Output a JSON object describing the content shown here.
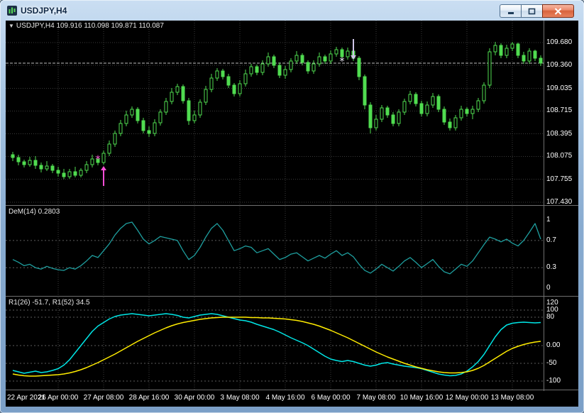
{
  "window": {
    "title": "USDJPY,H4"
  },
  "icons": {
    "triangle_down": "▼",
    "star": "*"
  },
  "chart": {
    "header": {
      "symbol": "USDJPY,H4",
      "quote": "109.916 110.098 109.871 110.087"
    }
  },
  "chart_data": {
    "type": "candlestick",
    "symbol": "USDJPY",
    "timeframe": "H4",
    "bar_count": 94,
    "price_range": [
      107.39,
      109.99
    ],
    "bid": 109.39,
    "price_ticks": [
      {
        "label": "109.680",
        "value": 109.68
      },
      {
        "label": "109.360",
        "value": 109.36
      },
      {
        "label": "109.035",
        "value": 109.035
      },
      {
        "label": "108.715",
        "value": 108.715
      },
      {
        "label": "108.395",
        "value": 108.395
      },
      {
        "label": "108.075",
        "value": 108.075
      },
      {
        "label": "107.755",
        "value": 107.755
      },
      {
        "label": "107.430",
        "value": 107.43
      }
    ],
    "time_ticks": [
      {
        "bar": 0,
        "label": "22 Apr 2021"
      },
      {
        "bar": 8,
        "label": "26 Apr 00:00"
      },
      {
        "bar": 16,
        "label": "27 Apr 08:00"
      },
      {
        "bar": 24,
        "label": "28 Apr 16:00"
      },
      {
        "bar": 32,
        "label": "30 Apr 00:00"
      },
      {
        "bar": 40,
        "label": "3 May 08:00"
      },
      {
        "bar": 48,
        "label": "4 May 16:00"
      },
      {
        "bar": 56,
        "label": "6 May 00:00"
      },
      {
        "bar": 64,
        "label": "7 May 08:00"
      },
      {
        "bar": 72,
        "label": "10 May 16:00"
      },
      {
        "bar": 80,
        "label": "12 May 00:00"
      },
      {
        "bar": 88,
        "label": "13 May 08:00"
      }
    ],
    "candles": [
      [
        108.1,
        108.14,
        108.01,
        108.06
      ],
      [
        108.06,
        108.1,
        107.95,
        108.0
      ],
      [
        108.0,
        108.03,
        107.92,
        107.96
      ],
      [
        107.96,
        108.07,
        107.93,
        108.02
      ],
      [
        108.02,
        108.08,
        107.9,
        107.95
      ],
      [
        107.95,
        107.99,
        107.85,
        107.9
      ],
      [
        107.9,
        108.01,
        107.87,
        107.94
      ],
      [
        107.94,
        107.97,
        107.84,
        107.88
      ],
      [
        107.88,
        107.93,
        107.79,
        107.84
      ],
      [
        107.84,
        107.9,
        107.755,
        107.79
      ],
      [
        107.79,
        107.9,
        107.76,
        107.86
      ],
      [
        107.86,
        107.93,
        107.78,
        107.81
      ],
      [
        107.81,
        107.91,
        107.78,
        107.88
      ],
      [
        107.88,
        108.01,
        107.84,
        107.96
      ],
      [
        107.96,
        108.1,
        107.92,
        108.04
      ],
      [
        108.04,
        108.08,
        107.95,
        107.99
      ],
      [
        107.99,
        108.16,
        107.96,
        108.12
      ],
      [
        108.12,
        108.3,
        108.08,
        108.25
      ],
      [
        108.25,
        108.44,
        108.21,
        108.4
      ],
      [
        108.4,
        108.59,
        108.36,
        108.54
      ],
      [
        108.54,
        108.72,
        108.5,
        108.66
      ],
      [
        108.66,
        108.78,
        108.62,
        108.74
      ],
      [
        108.74,
        108.77,
        108.54,
        108.58
      ],
      [
        108.58,
        108.62,
        108.4,
        108.44
      ],
      [
        108.44,
        108.5,
        108.35,
        108.4
      ],
      [
        108.4,
        108.6,
        108.36,
        108.55
      ],
      [
        108.55,
        108.74,
        108.51,
        108.7
      ],
      [
        108.7,
        108.9,
        108.66,
        108.85
      ],
      [
        108.85,
        109.04,
        108.81,
        108.98
      ],
      [
        108.98,
        109.1,
        108.94,
        109.06
      ],
      [
        109.06,
        109.09,
        108.82,
        108.86
      ],
      [
        108.86,
        108.9,
        108.52,
        108.58
      ],
      [
        108.58,
        108.72,
        108.54,
        108.66
      ],
      [
        108.66,
        108.88,
        108.62,
        108.84
      ],
      [
        108.84,
        109.07,
        108.8,
        109.02
      ],
      [
        109.02,
        109.24,
        108.98,
        109.18
      ],
      [
        109.18,
        109.32,
        109.14,
        109.28
      ],
      [
        109.28,
        109.31,
        109.16,
        109.2
      ],
      [
        109.2,
        109.24,
        109.04,
        109.08
      ],
      [
        109.08,
        109.11,
        108.92,
        108.96
      ],
      [
        108.96,
        109.15,
        108.92,
        109.1
      ],
      [
        109.1,
        109.3,
        109.06,
        109.24
      ],
      [
        109.24,
        109.38,
        109.2,
        109.34
      ],
      [
        109.34,
        109.37,
        109.22,
        109.26
      ],
      [
        109.26,
        109.43,
        109.22,
        109.38
      ],
      [
        109.38,
        109.54,
        109.34,
        109.48
      ],
      [
        109.48,
        109.51,
        109.32,
        109.36
      ],
      [
        109.36,
        109.4,
        109.18,
        109.22
      ],
      [
        109.22,
        109.35,
        109.17,
        109.3
      ],
      [
        109.3,
        109.46,
        109.26,
        109.42
      ],
      [
        109.42,
        109.56,
        109.38,
        109.5
      ],
      [
        109.5,
        109.53,
        109.36,
        109.4
      ],
      [
        109.4,
        109.43,
        109.24,
        109.28
      ],
      [
        109.28,
        109.43,
        109.24,
        109.38
      ],
      [
        109.38,
        109.54,
        109.34,
        109.48
      ],
      [
        109.48,
        109.51,
        109.38,
        109.42
      ],
      [
        109.42,
        109.57,
        109.38,
        109.52
      ],
      [
        109.52,
        109.62,
        109.48,
        109.58
      ],
      [
        109.58,
        109.61,
        109.44,
        109.48
      ],
      [
        109.48,
        109.61,
        109.44,
        109.56
      ],
      [
        109.56,
        109.6,
        109.42,
        109.46
      ],
      [
        109.46,
        109.49,
        109.15,
        109.2
      ],
      [
        109.2,
        109.23,
        108.74,
        108.8
      ],
      [
        108.8,
        108.84,
        108.4,
        108.48
      ],
      [
        108.48,
        108.66,
        108.44,
        108.6
      ],
      [
        108.6,
        108.8,
        108.56,
        108.76
      ],
      [
        108.76,
        108.79,
        108.62,
        108.66
      ],
      [
        108.66,
        108.7,
        108.5,
        108.54
      ],
      [
        108.54,
        108.74,
        108.5,
        108.7
      ],
      [
        108.7,
        108.89,
        108.66,
        108.85
      ],
      [
        108.85,
        109.0,
        108.81,
        108.95
      ],
      [
        108.95,
        108.98,
        108.78,
        108.82
      ],
      [
        108.82,
        108.86,
        108.64,
        108.68
      ],
      [
        108.68,
        108.85,
        108.64,
        108.8
      ],
      [
        108.8,
        108.97,
        108.76,
        108.92
      ],
      [
        108.92,
        108.95,
        108.7,
        108.74
      ],
      [
        108.74,
        108.78,
        108.52,
        108.56
      ],
      [
        108.56,
        108.61,
        108.44,
        108.48
      ],
      [
        108.48,
        108.66,
        108.44,
        108.62
      ],
      [
        108.62,
        108.79,
        108.58,
        108.74
      ],
      [
        108.74,
        108.77,
        108.64,
        108.68
      ],
      [
        108.68,
        108.79,
        108.6,
        108.74
      ],
      [
        108.74,
        108.9,
        108.7,
        108.86
      ],
      [
        108.86,
        109.12,
        108.82,
        109.08
      ],
      [
        109.08,
        109.6,
        109.04,
        109.55
      ],
      [
        109.55,
        109.69,
        109.5,
        109.64
      ],
      [
        109.64,
        109.67,
        109.46,
        109.5
      ],
      [
        109.5,
        109.65,
        109.46,
        109.6
      ],
      [
        109.6,
        109.69,
        109.56,
        109.66
      ],
      [
        109.66,
        109.68,
        109.46,
        109.5
      ],
      [
        109.5,
        109.55,
        109.38,
        109.42
      ],
      [
        109.42,
        109.6,
        109.38,
        109.56
      ],
      [
        109.56,
        109.58,
        109.42,
        109.46
      ],
      [
        109.46,
        109.5,
        109.35,
        109.39
      ]
    ],
    "indicators": {
      "dem": {
        "label": "DeM(14) 0.2803",
        "range": [
          -0.115,
          1.2
        ],
        "levels": [
          0.7,
          0.3
        ],
        "ticks": [
          {
            "label": "1",
            "value": 1
          },
          {
            "label": "0.7",
            "value": 0.7
          },
          {
            "label": "0.3",
            "value": 0.3
          },
          {
            "label": "0",
            "value": 0
          }
        ],
        "values": [
          0.42,
          0.38,
          0.33,
          0.35,
          0.3,
          0.28,
          0.32,
          0.29,
          0.27,
          0.26,
          0.3,
          0.28,
          0.33,
          0.4,
          0.48,
          0.45,
          0.55,
          0.65,
          0.78,
          0.88,
          0.95,
          0.97,
          0.85,
          0.72,
          0.65,
          0.7,
          0.76,
          0.74,
          0.72,
          0.7,
          0.55,
          0.42,
          0.48,
          0.6,
          0.75,
          0.88,
          0.95,
          0.85,
          0.7,
          0.55,
          0.58,
          0.62,
          0.6,
          0.52,
          0.55,
          0.58,
          0.5,
          0.42,
          0.45,
          0.5,
          0.52,
          0.46,
          0.4,
          0.44,
          0.48,
          0.44,
          0.5,
          0.55,
          0.48,
          0.52,
          0.46,
          0.35,
          0.26,
          0.22,
          0.28,
          0.35,
          0.3,
          0.25,
          0.32,
          0.4,
          0.45,
          0.38,
          0.3,
          0.36,
          0.42,
          0.32,
          0.24,
          0.21,
          0.28,
          0.35,
          0.32,
          0.4,
          0.52,
          0.64,
          0.75,
          0.72,
          0.68,
          0.72,
          0.66,
          0.62,
          0.7,
          0.82,
          0.95,
          0.72
        ]
      },
      "wpr": {
        "label": "R1(26) -51.7, R1(52) 34.5",
        "range": [
          -124,
          136
        ],
        "levels": [
          100,
          80,
          0,
          -50,
          -100
        ],
        "ticks": [
          {
            "label": "120",
            "value": 120
          },
          {
            "label": "100",
            "value": 100
          },
          {
            "label": "80",
            "value": 80
          },
          {
            "label": "0.00",
            "value": 0
          },
          {
            "label": "-50",
            "value": -50
          },
          {
            "label": "-100",
            "value": -100
          }
        ],
        "series": [
          {
            "name": "R1(26)",
            "color": "#00e6e6",
            "values": [
              -70,
              -74,
              -78,
              -75,
              -72,
              -76,
              -74,
              -70,
              -65,
              -55,
              -40,
              -20,
              0,
              20,
              40,
              55,
              65,
              75,
              82,
              86,
              88,
              90,
              88,
              86,
              84,
              86,
              88,
              90,
              88,
              85,
              80,
              78,
              82,
              86,
              88,
              90,
              88,
              84,
              80,
              76,
              72,
              70,
              66,
              60,
              55,
              50,
              45,
              38,
              30,
              22,
              15,
              8,
              0,
              -10,
              -20,
              -30,
              -38,
              -42,
              -45,
              -42,
              -45,
              -50,
              -55,
              -58,
              -55,
              -50,
              -48,
              -52,
              -55,
              -58,
              -60,
              -62,
              -65,
              -70,
              -75,
              -80,
              -83,
              -85,
              -84,
              -80,
              -72,
              -60,
              -45,
              -25,
              0,
              25,
              45,
              58,
              63,
              65,
              66,
              65,
              64,
              65
            ]
          },
          {
            "name": "R1(52)",
            "color": "#ffec00",
            "values": [
              -80,
              -83,
              -85,
              -86,
              -86,
              -85,
              -84,
              -83,
              -82,
              -80,
              -77,
              -73,
              -68,
              -62,
              -55,
              -48,
              -40,
              -32,
              -24,
              -15,
              -6,
              3,
              12,
              20,
              28,
              36,
              43,
              50,
              56,
              61,
              65,
              68,
              71,
              74,
              76,
              78,
              79,
              80,
              80,
              80,
              80,
              80,
              79,
              79,
              78,
              78,
              77,
              76,
              75,
              73,
              71,
              68,
              64,
              60,
              55,
              49,
              43,
              36,
              29,
              22,
              14,
              6,
              -2,
              -10,
              -18,
              -25,
              -32,
              -38,
              -44,
              -50,
              -55,
              -60,
              -64,
              -68,
              -71,
              -74,
              -76,
              -77,
              -77,
              -76,
              -74,
              -70,
              -64,
              -56,
              -46,
              -36,
              -26,
              -16,
              -8,
              -2,
              3,
              7,
              10,
              12
            ]
          }
        ]
      }
    },
    "markers": [
      {
        "dir": "up",
        "bar": 16,
        "from_price": 107.66,
        "to_price": 107.88,
        "color": "#ff4fd8",
        "star": {
          "bar": 15,
          "price": 108.03,
          "color": "#ff4fd8"
        }
      },
      {
        "dir": "down",
        "bar": 60,
        "from_price": 109.73,
        "to_price": 109.5,
        "color": "#cfc5e8",
        "star": {
          "bar": 58,
          "price": 109.41,
          "color": "#f5f2ff"
        }
      }
    ],
    "colors": {
      "background": "#000000",
      "grid": "#3a3a3a",
      "level": "#5c5c5c",
      "candle": "#50dc50",
      "bull_fill": "#000000",
      "bear_fill": "#50dc50",
      "bid_line": "#bdbdbd",
      "dem_line": "#1e9e9e",
      "axis_text": "#ffffff",
      "separator": "#6f6f6f"
    }
  }
}
